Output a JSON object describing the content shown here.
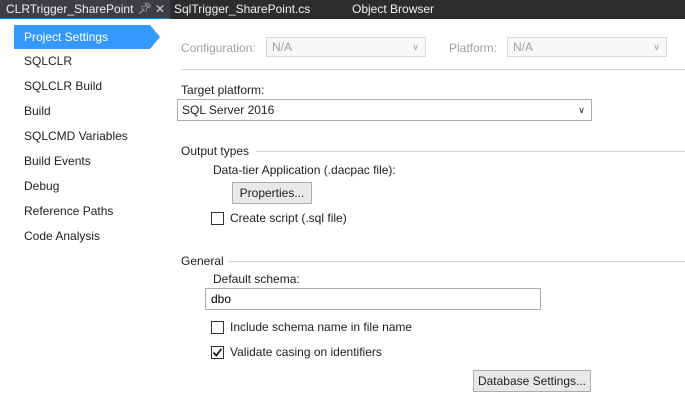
{
  "tabs": [
    {
      "label": "CLRTrigger_SharePoint",
      "active": true
    },
    {
      "label": "SqlTrigger_SharePoint.cs",
      "active": false
    },
    {
      "label": "Object Browser",
      "active": false
    }
  ],
  "tab_icons": {
    "pin": "pin-icon",
    "close": "close-icon"
  },
  "nav": {
    "items": [
      {
        "label": "Project Settings",
        "selected": true
      },
      {
        "label": "SQLCLR"
      },
      {
        "label": "SQLCLR Build"
      },
      {
        "label": "Build"
      },
      {
        "label": "SQLCMD Variables"
      },
      {
        "label": "Build Events"
      },
      {
        "label": "Debug"
      },
      {
        "label": "Reference Paths"
      },
      {
        "label": "Code Analysis"
      }
    ]
  },
  "config": {
    "configuration_label": "Configuration:",
    "configuration_value": "N/A",
    "platform_label": "Platform:",
    "platform_value": "N/A"
  },
  "target": {
    "label": "Target platform:",
    "value": "SQL Server 2016"
  },
  "output": {
    "section_title": "Output types",
    "dacpac_label": "Data-tier Application (.dacpac file):",
    "properties_button": "Properties...",
    "create_script_label": "Create script (.sql file)",
    "create_script_checked": false
  },
  "general": {
    "section_title": "General",
    "default_schema_label": "Default schema:",
    "default_schema_value": "dbo",
    "include_schema_label": "Include schema name in file name",
    "include_schema_checked": false,
    "validate_casing_label": "Validate casing on identifiers",
    "validate_casing_checked": true,
    "database_settings_button": "Database Settings..."
  },
  "colors": {
    "selection": "#3399ff",
    "tabstrip": "#2d2d30",
    "accent": "#007acc"
  }
}
